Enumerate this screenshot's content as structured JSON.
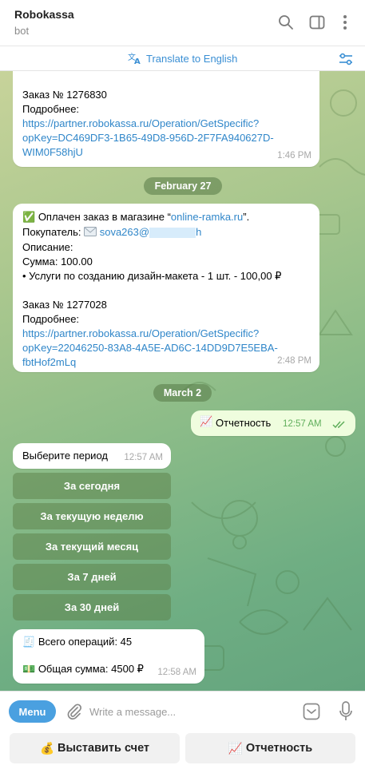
{
  "header": {
    "title": "Robokassa",
    "subtitle": "bot"
  },
  "translate": {
    "label": "Translate to English"
  },
  "messages": {
    "msg1": {
      "partial_line": "…",
      "order": "Заказ № 1276830",
      "details_label": "Подробнее:",
      "link_line1": "https://partner.robokassa.ru/Operation/GetSpecific?",
      "link_line2": "opKey=DC469DF3-1B65-49D8-956D-2F7FA940627D-",
      "link_line3": "WIM0F58hjU",
      "time": "1:46 PM"
    },
    "date1": "February 27",
    "msg2": {
      "check": "✅",
      "paid_text": "Оплачен заказ в магазине “",
      "shop_link": "online-ramka.ru",
      "paid_end": "”.",
      "buyer_label": "Покупатель:",
      "buyer_email": "sova263@",
      "buyer_email_end": "h",
      "description_label": "Описание:",
      "sum": "Сумма: 100.00",
      "item": "• Услуги по созданию дизайн-макета - 1 шт. - 100,00 ₽",
      "order": "Заказ № 1277028",
      "details_label": "Подробнее:",
      "link_line1": "https://partner.robokassa.ru/Operation/GetSpecific?",
      "link_line2": "opKey=22046250-83A8-4A5E-AD6C-14DD9D7E5EBA-",
      "link_line3": "fbtHof2mLq",
      "time": "2:48 PM"
    },
    "date2": "March 2",
    "out1": {
      "emoji": "📈",
      "text": "Отчетность",
      "time": "12:57 AM"
    },
    "msg3": {
      "text": "Выберите период",
      "time": "12:57 AM"
    },
    "inline_buttons": [
      "За сегодня",
      "За текущую неделю",
      "За текущий месяц",
      "За 7 дней",
      "За 30 дней"
    ],
    "msg4": {
      "line1_emoji": "🧾",
      "line1": "Всего операций: 45",
      "line2_emoji": "💵",
      "line2": "Общая сумма: 4500 ₽",
      "time": "12:58 AM"
    }
  },
  "composer": {
    "menu_label": "Menu",
    "placeholder": "Write a message..."
  },
  "reply_keyboard": {
    "left_emoji": "💰",
    "left_label": "Выставить счет",
    "right_emoji": "📈",
    "right_label": "Отчетность"
  },
  "colors": {
    "accent": "#4aa0e0",
    "link": "#2f86c9",
    "outgoing_bubble": "#effdde",
    "check_green": "#4fae4e"
  },
  "icons": {
    "search": "search-icon",
    "panel": "sidebar-toggle-icon",
    "more": "more-vertical-icon",
    "translate": "translate-icon",
    "settings": "sliders-icon",
    "attach": "paperclip-icon",
    "sticker": "sticker-icon",
    "mic": "microphone-icon",
    "read": "double-check-icon"
  }
}
